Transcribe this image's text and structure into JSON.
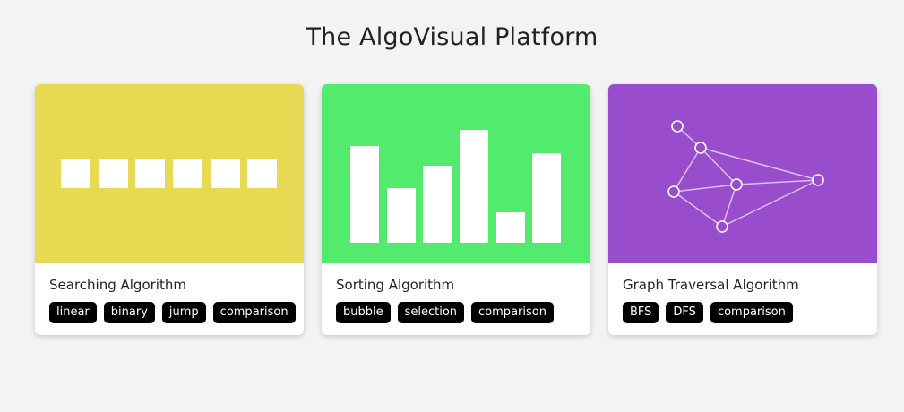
{
  "page": {
    "title": "The AlgoVisual Platform"
  },
  "cards": [
    {
      "title": "Searching Algorithm",
      "bg_color": "#e8d952",
      "visual": "array-boxes",
      "tags": [
        "linear",
        "binary",
        "jump",
        "comparison"
      ]
    },
    {
      "title": "Sorting Algorithm",
      "bg_color": "#53eb6e",
      "visual": "bar-columns",
      "tags": [
        "bubble",
        "selection",
        "comparison"
      ]
    },
    {
      "title": "Graph Traversal Algorithm",
      "bg_color": "#994ccc",
      "visual": "node-graph",
      "tags": [
        "BFS",
        "DFS",
        "comparison"
      ]
    }
  ]
}
